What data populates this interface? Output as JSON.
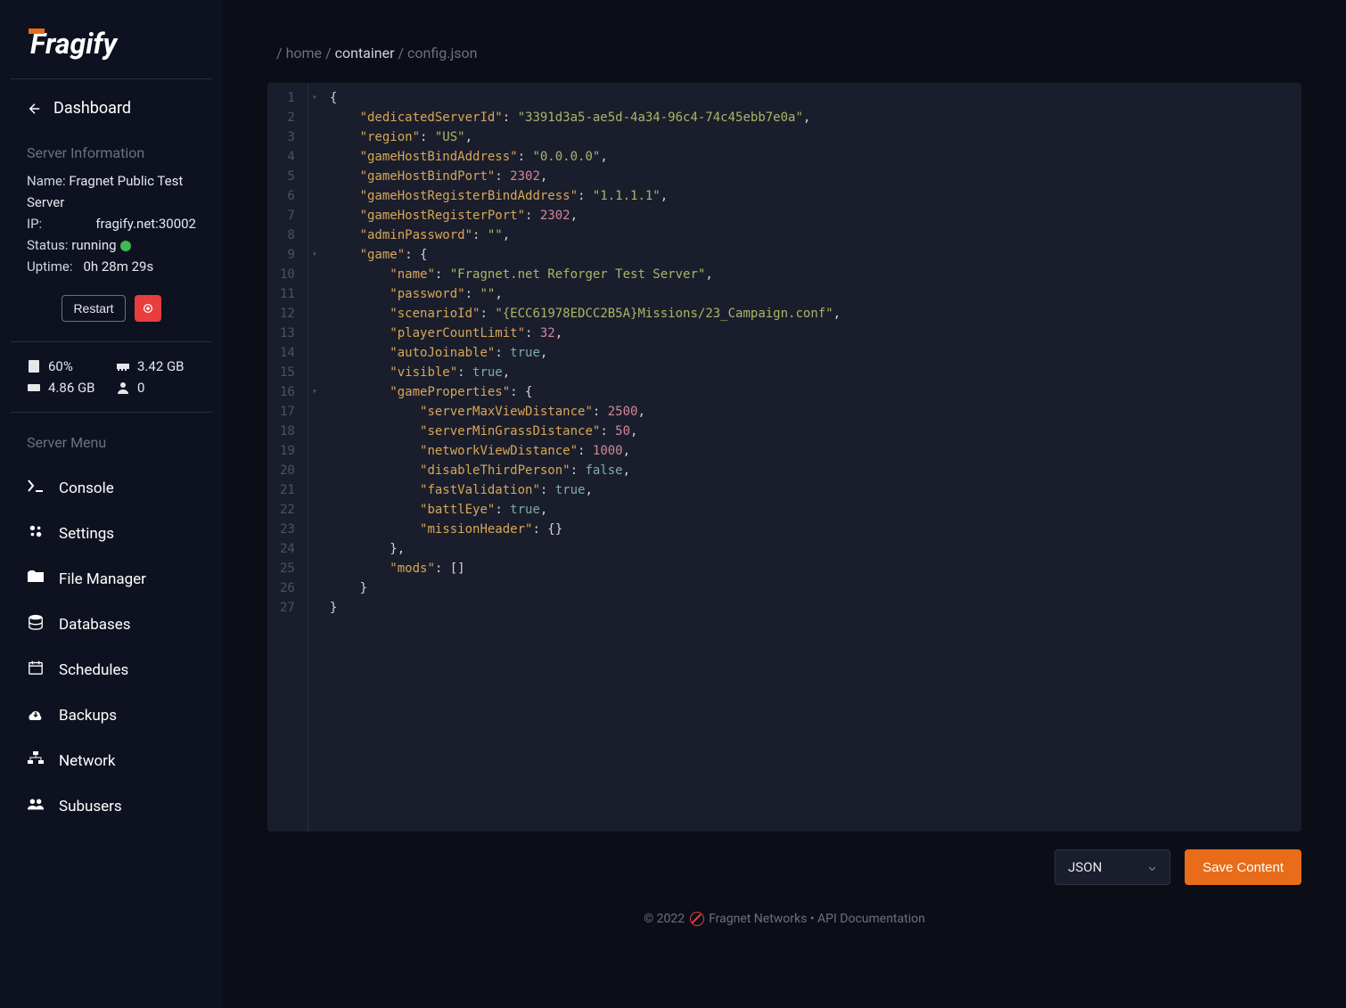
{
  "logo_text": "ragify",
  "dashboard_label": "Dashboard",
  "server_info": {
    "title": "Server Information",
    "name_label": "Name:",
    "name_value": "Fragnet Public Test Server",
    "ip_label": "IP:",
    "ip_value": "fragify.net:30002",
    "status_label": "Status:",
    "status_value": "running",
    "uptime_label": "Uptime:",
    "uptime_value": "0h 28m 29s"
  },
  "buttons": {
    "restart": "Restart"
  },
  "stats": {
    "cpu": "60%",
    "ram": "3.42 GB",
    "disk": "4.86 GB",
    "players": "0"
  },
  "server_menu_title": "Server Menu",
  "menu": [
    {
      "label": "Console"
    },
    {
      "label": "Settings"
    },
    {
      "label": "File Manager"
    },
    {
      "label": "Databases"
    },
    {
      "label": "Schedules"
    },
    {
      "label": "Backups"
    },
    {
      "label": "Network"
    },
    {
      "label": "Subusers"
    }
  ],
  "breadcrumb": {
    "home": "home",
    "container": "container",
    "file": "config.json"
  },
  "code_lines": [
    {
      "n": 1,
      "fold": "▾",
      "indent": 0,
      "tokens": [
        {
          "c": "p",
          "t": "{"
        }
      ]
    },
    {
      "n": 2,
      "indent": 1,
      "tokens": [
        {
          "c": "k",
          "t": "\"dedicatedServerId\""
        },
        {
          "c": "p",
          "t": ": "
        },
        {
          "c": "s",
          "t": "\"3391d3a5-ae5d-4a34-96c4-74c45ebb7e0a\""
        },
        {
          "c": "p",
          "t": ","
        }
      ]
    },
    {
      "n": 3,
      "indent": 1,
      "tokens": [
        {
          "c": "k",
          "t": "\"region\""
        },
        {
          "c": "p",
          "t": ": "
        },
        {
          "c": "s",
          "t": "\"US\""
        },
        {
          "c": "p",
          "t": ","
        }
      ]
    },
    {
      "n": 4,
      "indent": 1,
      "tokens": [
        {
          "c": "k",
          "t": "\"gameHostBindAddress\""
        },
        {
          "c": "p",
          "t": ": "
        },
        {
          "c": "s",
          "t": "\"0.0.0.0\""
        },
        {
          "c": "p",
          "t": ","
        }
      ]
    },
    {
      "n": 5,
      "indent": 1,
      "tokens": [
        {
          "c": "k",
          "t": "\"gameHostBindPort\""
        },
        {
          "c": "p",
          "t": ": "
        },
        {
          "c": "n",
          "t": "2302"
        },
        {
          "c": "p",
          "t": ","
        }
      ]
    },
    {
      "n": 6,
      "indent": 1,
      "tokens": [
        {
          "c": "k",
          "t": "\"gameHostRegisterBindAddress\""
        },
        {
          "c": "p",
          "t": ": "
        },
        {
          "c": "s",
          "t": "\"1.1.1.1\""
        },
        {
          "c": "p",
          "t": ","
        }
      ]
    },
    {
      "n": 7,
      "indent": 1,
      "tokens": [
        {
          "c": "k",
          "t": "\"gameHostRegisterPort\""
        },
        {
          "c": "p",
          "t": ": "
        },
        {
          "c": "n",
          "t": "2302"
        },
        {
          "c": "p",
          "t": ","
        }
      ]
    },
    {
      "n": 8,
      "indent": 1,
      "tokens": [
        {
          "c": "k",
          "t": "\"adminPassword\""
        },
        {
          "c": "p",
          "t": ": "
        },
        {
          "c": "s",
          "t": "\"\""
        },
        {
          "c": "p",
          "t": ","
        }
      ]
    },
    {
      "n": 9,
      "fold": "▾",
      "indent": 1,
      "tokens": [
        {
          "c": "k",
          "t": "\"game\""
        },
        {
          "c": "p",
          "t": ": {"
        }
      ]
    },
    {
      "n": 10,
      "indent": 2,
      "tokens": [
        {
          "c": "k",
          "t": "\"name\""
        },
        {
          "c": "p",
          "t": ": "
        },
        {
          "c": "s",
          "t": "\"Fragnet.net Reforger Test Server\""
        },
        {
          "c": "p",
          "t": ","
        }
      ]
    },
    {
      "n": 11,
      "indent": 2,
      "tokens": [
        {
          "c": "k",
          "t": "\"password\""
        },
        {
          "c": "p",
          "t": ": "
        },
        {
          "c": "s",
          "t": "\"\""
        },
        {
          "c": "p",
          "t": ","
        }
      ]
    },
    {
      "n": 12,
      "indent": 2,
      "tokens": [
        {
          "c": "k",
          "t": "\"scenarioId\""
        },
        {
          "c": "p",
          "t": ": "
        },
        {
          "c": "s",
          "t": "\"{ECC61978EDCC2B5A}Missions/23_Campaign.conf\""
        },
        {
          "c": "p",
          "t": ","
        }
      ]
    },
    {
      "n": 13,
      "indent": 2,
      "tokens": [
        {
          "c": "k",
          "t": "\"playerCountLimit\""
        },
        {
          "c": "p",
          "t": ": "
        },
        {
          "c": "n",
          "t": "32"
        },
        {
          "c": "p",
          "t": ","
        }
      ]
    },
    {
      "n": 14,
      "indent": 2,
      "tokens": [
        {
          "c": "k",
          "t": "\"autoJoinable\""
        },
        {
          "c": "p",
          "t": ": "
        },
        {
          "c": "b",
          "t": "true"
        },
        {
          "c": "p",
          "t": ","
        }
      ]
    },
    {
      "n": 15,
      "indent": 2,
      "tokens": [
        {
          "c": "k",
          "t": "\"visible\""
        },
        {
          "c": "p",
          "t": ": "
        },
        {
          "c": "b",
          "t": "true"
        },
        {
          "c": "p",
          "t": ","
        }
      ]
    },
    {
      "n": 16,
      "fold": "▾",
      "indent": 2,
      "tokens": [
        {
          "c": "k",
          "t": "\"gameProperties\""
        },
        {
          "c": "p",
          "t": ": {"
        }
      ]
    },
    {
      "n": 17,
      "indent": 3,
      "tokens": [
        {
          "c": "k",
          "t": "\"serverMaxViewDistance\""
        },
        {
          "c": "p",
          "t": ": "
        },
        {
          "c": "n",
          "t": "2500"
        },
        {
          "c": "p",
          "t": ","
        }
      ]
    },
    {
      "n": 18,
      "indent": 3,
      "tokens": [
        {
          "c": "k",
          "t": "\"serverMinGrassDistance\""
        },
        {
          "c": "p",
          "t": ": "
        },
        {
          "c": "n",
          "t": "50"
        },
        {
          "c": "p",
          "t": ","
        }
      ]
    },
    {
      "n": 19,
      "indent": 3,
      "tokens": [
        {
          "c": "k",
          "t": "\"networkViewDistance\""
        },
        {
          "c": "p",
          "t": ": "
        },
        {
          "c": "n",
          "t": "1000"
        },
        {
          "c": "p",
          "t": ","
        }
      ]
    },
    {
      "n": 20,
      "indent": 3,
      "tokens": [
        {
          "c": "k",
          "t": "\"disableThirdPerson\""
        },
        {
          "c": "p",
          "t": ": "
        },
        {
          "c": "b",
          "t": "false"
        },
        {
          "c": "p",
          "t": ","
        }
      ]
    },
    {
      "n": 21,
      "indent": 3,
      "tokens": [
        {
          "c": "k",
          "t": "\"fastValidation\""
        },
        {
          "c": "p",
          "t": ": "
        },
        {
          "c": "b",
          "t": "true"
        },
        {
          "c": "p",
          "t": ","
        }
      ]
    },
    {
      "n": 22,
      "indent": 3,
      "tokens": [
        {
          "c": "k",
          "t": "\"battlEye\""
        },
        {
          "c": "p",
          "t": ": "
        },
        {
          "c": "b",
          "t": "true"
        },
        {
          "c": "p",
          "t": ","
        }
      ]
    },
    {
      "n": 23,
      "indent": 3,
      "tokens": [
        {
          "c": "k",
          "t": "\"missionHeader\""
        },
        {
          "c": "p",
          "t": ": {}"
        }
      ]
    },
    {
      "n": 24,
      "indent": 2,
      "tokens": [
        {
          "c": "p",
          "t": "},"
        }
      ]
    },
    {
      "n": 25,
      "indent": 2,
      "tokens": [
        {
          "c": "k",
          "t": "\"mods\""
        },
        {
          "c": "p",
          "t": ": []"
        }
      ]
    },
    {
      "n": 26,
      "indent": 1,
      "tokens": [
        {
          "c": "p",
          "t": "}"
        }
      ]
    },
    {
      "n": 27,
      "indent": 0,
      "tokens": [
        {
          "c": "p",
          "t": "}"
        }
      ]
    }
  ],
  "format_select": "JSON",
  "save_label": "Save Content",
  "footer": {
    "copyright": "© 2022",
    "brand": "Fragnet Networks",
    "sep": " • ",
    "api": "API Documentation"
  }
}
